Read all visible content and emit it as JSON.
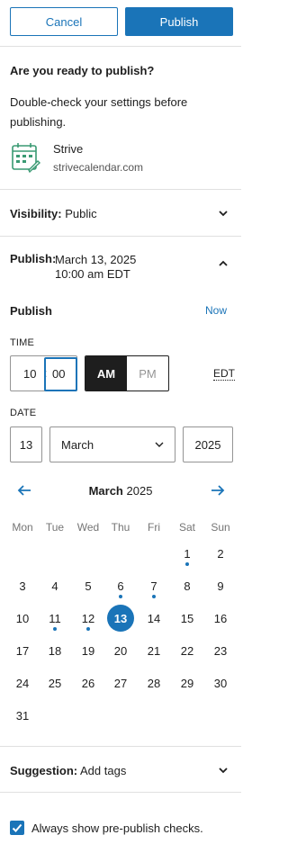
{
  "header": {
    "cancel_label": "Cancel",
    "publish_label": "Publish"
  },
  "prepublish": {
    "title": "Are you ready to publish?",
    "description": "Double-check your settings before publishing.",
    "site_name": "Strive",
    "site_url": "strivecalendar.com",
    "site_icon": "calendar-pencil-icon"
  },
  "visibility": {
    "label": "Visibility:",
    "value": "Public"
  },
  "publish_panel": {
    "label": "Publish:",
    "date_line": "March 13, 2025",
    "time_line": "10:00 am EDT"
  },
  "publish_picker": {
    "heading": "Publish",
    "now_label": "Now",
    "time_caption": "TIME",
    "hour": "10",
    "separator": ":",
    "minute": "00",
    "am_label": "AM",
    "pm_label": "PM",
    "timezone": "EDT",
    "date_caption": "DATE",
    "day": "13",
    "month": "March",
    "year": "2025"
  },
  "calendar": {
    "month_label": "March",
    "year_label": "2025",
    "weekdays": [
      "Mon",
      "Tue",
      "Wed",
      "Thu",
      "Fri",
      "Sat",
      "Sun"
    ],
    "first_weekday_index": 5,
    "days_in_month": 31,
    "selected_day": 13,
    "days_with_posts": [
      1,
      6,
      7,
      11,
      12
    ]
  },
  "suggestion": {
    "label": "Suggestion:",
    "value": "Add tags"
  },
  "footer": {
    "checkbox_label": "Always show pre-publish checks.",
    "checked": true
  },
  "colors": {
    "accent": "#1a74b8",
    "selected_day_bg": "#1a74b8",
    "am_active_bg": "#1e1e1e"
  }
}
